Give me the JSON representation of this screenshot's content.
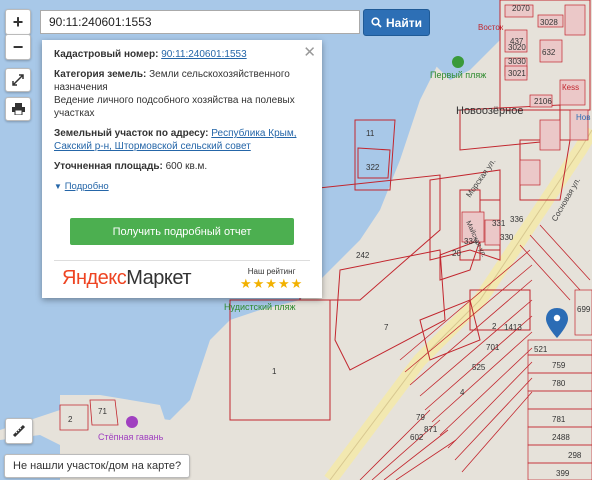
{
  "search": {
    "value": "90:11:240601:1553",
    "button_label": "Найти"
  },
  "controls": {
    "zoom_in": "+",
    "zoom_out": "−"
  },
  "popup": {
    "cadastral_label": "Кадастровый номер:",
    "cadastral_value": "90:11:240601:1553",
    "category_label": "Категория земель:",
    "category_value": "Земли сельскохозяйственного назначения",
    "use_value": "Ведение личного подсобного хозяйства на полевых участках",
    "address_label": "Земельный участок по адресу:",
    "address_line1": "Республика Крым,",
    "address_line2": "Сакский р-н, Штормовской сельский совет",
    "area_label": "Уточненная площадь:",
    "area_value": "600 кв.м.",
    "detail_link": "Подробно",
    "report_button": "Получить подробный отчет",
    "ad_brand_1": "Яндекс",
    "ad_brand_2": "Маркет",
    "rating_label": "Наш рейтинг",
    "stars": "★★★★★"
  },
  "map_labels": {
    "village": "Новоозёрное",
    "beach1": "Первый пляж",
    "beach2": "Нудистский пляж",
    "harbor": "Стёпная гавань",
    "street1": "Морская ул.",
    "street2": "Сосновая ул.",
    "street3": "Майская ул.",
    "poi1": "Восток",
    "poi2": "Кеѕѕ",
    "poi3": "Нов"
  },
  "parcels": [
    "2070",
    "3028",
    "3020",
    "437",
    "632",
    "3030",
    "3021",
    "2106",
    "11",
    "322",
    "242",
    "7",
    "20",
    "334",
    "331",
    "336",
    "330",
    "1413",
    "2",
    "701",
    "525",
    "4",
    "1",
    "521",
    "759",
    "780",
    "781",
    "2488",
    "399",
    "298",
    "699",
    "71",
    "2",
    "79",
    "871",
    "602"
  ],
  "not_found_label": "Не нашли участок/дом на карте?",
  "colors": {
    "water": "#a8c8e8",
    "land": "#e6e2da",
    "parcel": "#c2262e",
    "accent": "#2d6fb5",
    "marker": "#2b6cb5",
    "report": "#4caf50"
  }
}
